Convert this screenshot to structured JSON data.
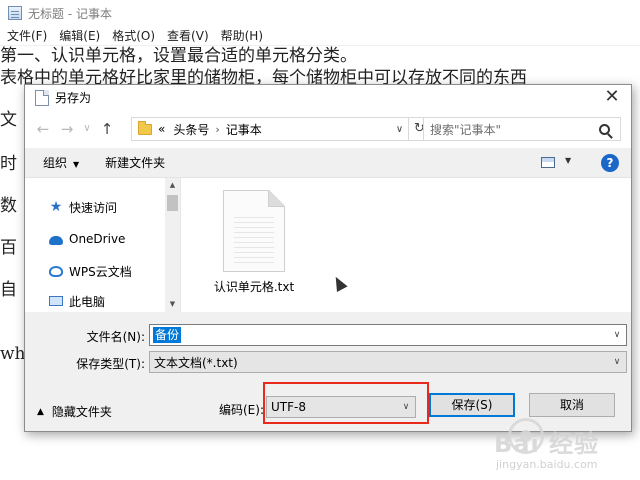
{
  "notepad": {
    "title": "无标题 - 记事本",
    "menu": [
      "文件(F)",
      "编辑(E)",
      "格式(O)",
      "查看(V)",
      "帮助(H)"
    ],
    "lines": {
      "heading": "第一、认识单元格，设置最合适的单元格分类。",
      "line2": "表格中的单元格好比家里的储物柜，每个储物柜中可以存放不同的东西",
      "frag_wen": "文",
      "frag_shi": "时",
      "frag_shu": "数",
      "frag_bai": "百",
      "frag_zi": "自",
      "frag_whe": "whe"
    }
  },
  "dialog": {
    "title": "另存为",
    "close_glyph": "✕",
    "nav": {
      "back_glyph": "←",
      "forward_glyph": "→",
      "recent_glyph": "∨",
      "up_glyph": "↑"
    },
    "address": {
      "overflow": "«",
      "crumbs": [
        "头条号",
        "记事本"
      ],
      "separator": "›",
      "dropdown_glyph": "∨",
      "refresh_glyph": "↻"
    },
    "search": {
      "placeholder": "搜索\"记事本\""
    },
    "toolbar": {
      "organize": "组织",
      "new_folder": "新建文件夹",
      "caret": "▼",
      "help_glyph": "?"
    },
    "nav_pane": {
      "items": [
        "快速访问",
        "OneDrive",
        "WPS云文档",
        "此电脑"
      ]
    },
    "files": [
      {
        "name": "认识单元格.txt"
      }
    ],
    "filename": {
      "label": "文件名(N):",
      "value": "备份"
    },
    "filetype": {
      "label": "保存类型(T):",
      "value": "文本文档(*.txt)"
    },
    "hide_folders": "隐藏文件夹",
    "encoding": {
      "label": "编码(E):",
      "value": "UTF-8"
    },
    "buttons": {
      "save": "保存(S)",
      "cancel": "取消"
    }
  },
  "watermark": {
    "text": "Bai 经验",
    "sub": "jingyan.baidu.com"
  },
  "colors": {
    "selection": "#0078d7",
    "highlight_box": "#e8291c",
    "help_icon": "#1b67c8",
    "folder": "#f2c84b"
  }
}
